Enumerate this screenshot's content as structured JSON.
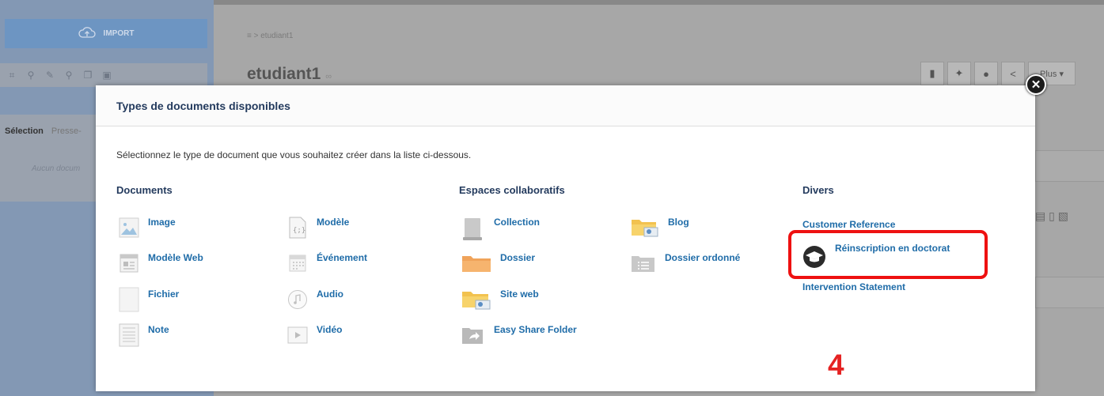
{
  "background": {
    "import_label": "IMPORT",
    "breadcrumb": "≡ > etudiant1",
    "doc_title": "etudiant1",
    "doc_title_suffix": "∞",
    "left_tabs": [
      "Sélection",
      "Presse-"
    ],
    "left_empty": "Aucun docum",
    "plus_label": "Plus ▾"
  },
  "modal": {
    "title": "Types de documents disponibles",
    "instruction": "Sélectionnez le type de document que vous souhaitez créer dans la liste ci-dessous.",
    "close_icon": "close-icon",
    "columns": {
      "documents": {
        "heading": "Documents",
        "items": [
          {
            "label": "Image",
            "icon": "image-icon"
          },
          {
            "label": "Modèle Web",
            "icon": "web-template-icon"
          },
          {
            "label": "Fichier",
            "icon": "file-icon"
          },
          {
            "label": "Note",
            "icon": "note-icon"
          },
          {
            "label": "Modèle",
            "icon": "template-icon"
          },
          {
            "label": "Événement",
            "icon": "calendar-icon"
          },
          {
            "label": "Audio",
            "icon": "audio-icon"
          },
          {
            "label": "Vidéo",
            "icon": "video-icon"
          }
        ]
      },
      "espaces": {
        "heading": "Espaces collaboratifs",
        "items": [
          {
            "label": "Collection",
            "icon": "collection-icon"
          },
          {
            "label": "Dossier",
            "icon": "folder-icon"
          },
          {
            "label": "Site web",
            "icon": "website-folder-icon"
          },
          {
            "label": "Easy Share Folder",
            "icon": "share-folder-icon"
          },
          {
            "label": "Blog",
            "icon": "blog-folder-icon"
          },
          {
            "label": "Dossier ordonné",
            "icon": "ordered-folder-icon"
          }
        ]
      },
      "divers": {
        "heading": "Divers",
        "items": [
          {
            "label": "Customer Reference",
            "icon": ""
          },
          {
            "label": "Réinscription en doctorat",
            "icon": "graduation-cap-icon"
          },
          {
            "label": "Intervention Statement",
            "icon": ""
          }
        ]
      }
    }
  },
  "annotation": {
    "step_number": "4",
    "highlight_color": "#ee1111"
  },
  "colors": {
    "link": "#1f6ca8",
    "heading": "#243b5e",
    "overlay": "#a7a7a7"
  }
}
